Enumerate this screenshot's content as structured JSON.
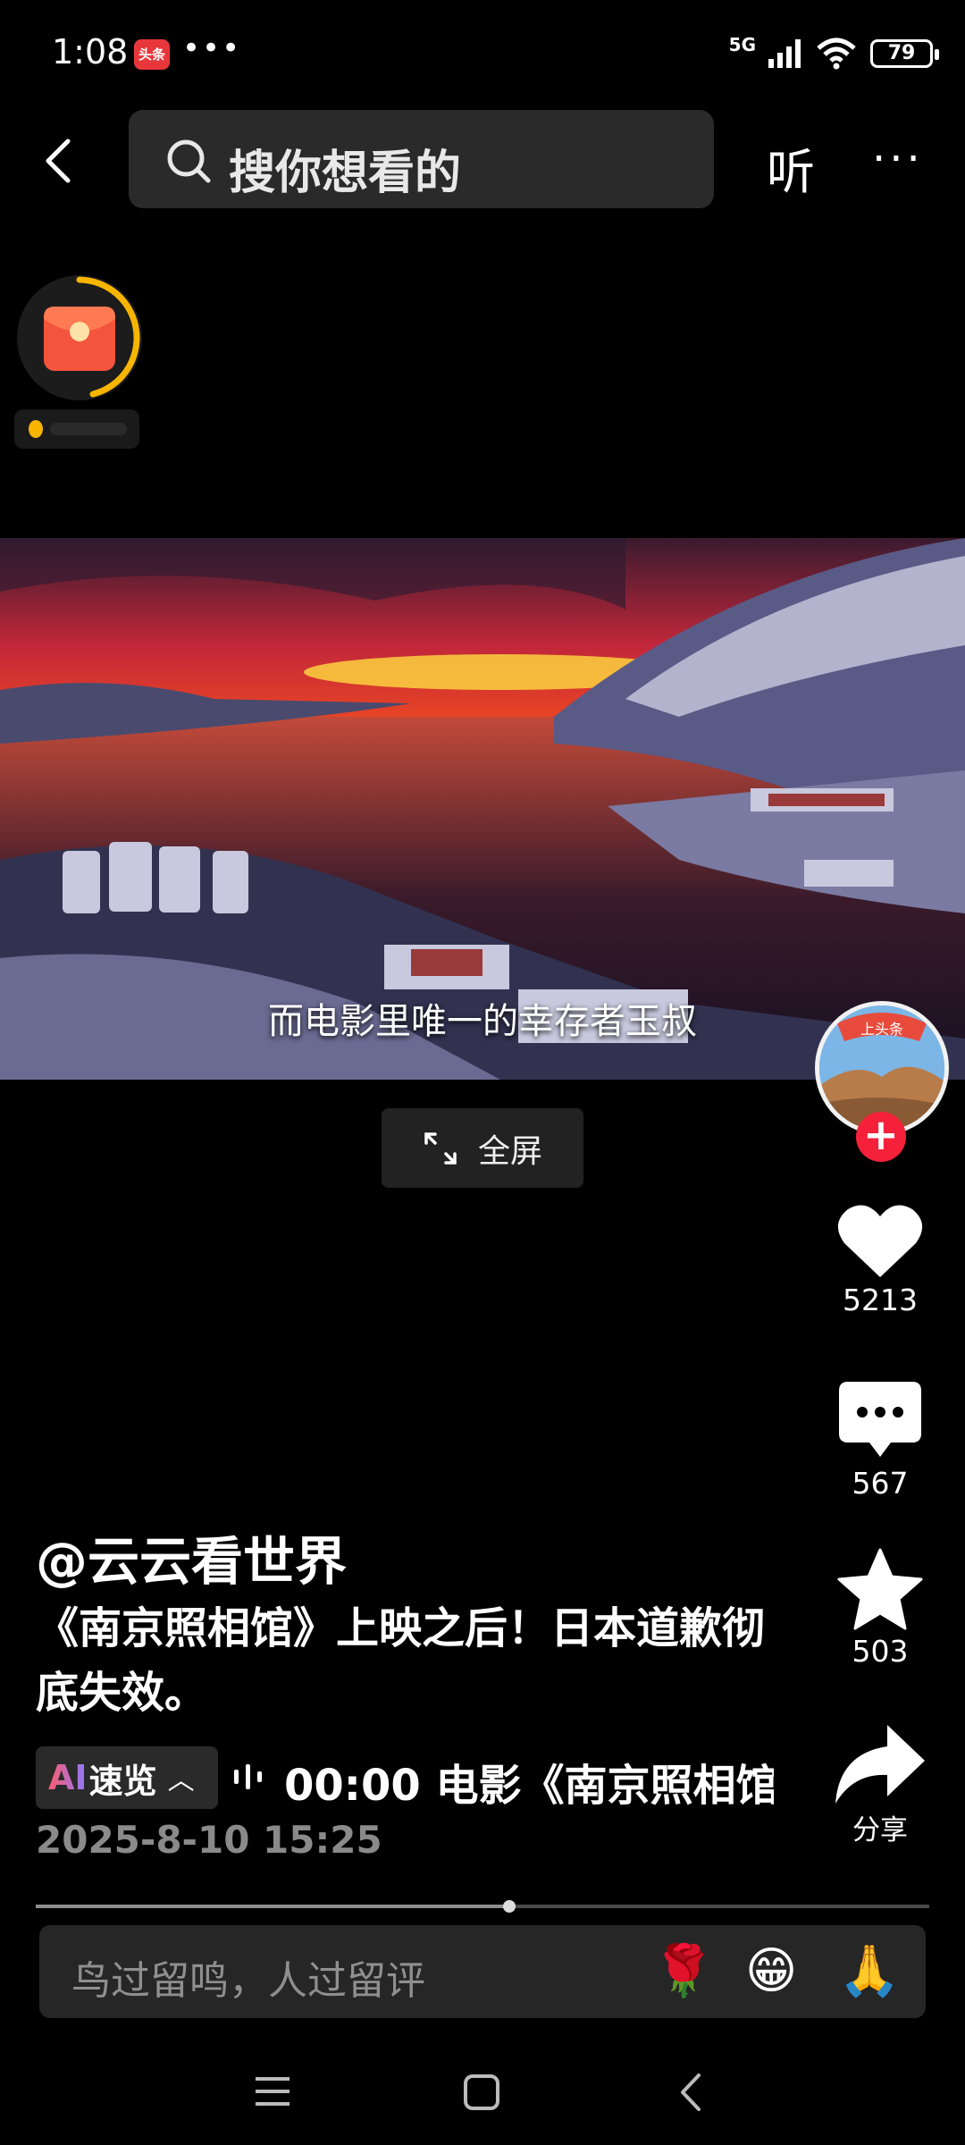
{
  "status_bar": {
    "time": "1:08",
    "app_badge": "头条",
    "more": "•••",
    "network": "5G",
    "battery": "79"
  },
  "header": {
    "search_placeholder": "搜你想看的",
    "listen_label": "听",
    "more_label": "···"
  },
  "video": {
    "subtitle": "而电影里唯一的幸存者玉叔",
    "fullscreen_label": "全屏"
  },
  "rail": {
    "avatar_badge": "上头条",
    "follow_label": "+",
    "like_count": "5213",
    "comment_count": "567",
    "favorite_count": "503",
    "share_label": "分享"
  },
  "post": {
    "author": "@云云看世界",
    "caption": "《南京照相馆》上映之后！日本道歉彻底失效。",
    "ai_badge": "AI",
    "ai_label": "速览",
    "summary": "00:00 电影《南京照相馆",
    "date": "2025-8-10 15:25",
    "progress": 0.53
  },
  "comment": {
    "placeholder": "鸟过留鸣，人过留评",
    "emojis": [
      "🌹",
      "😁",
      "🙏"
    ]
  },
  "colors": {
    "accent_red": "#f5213b",
    "ring_yellow": "#f7b500",
    "background": "#000000"
  }
}
